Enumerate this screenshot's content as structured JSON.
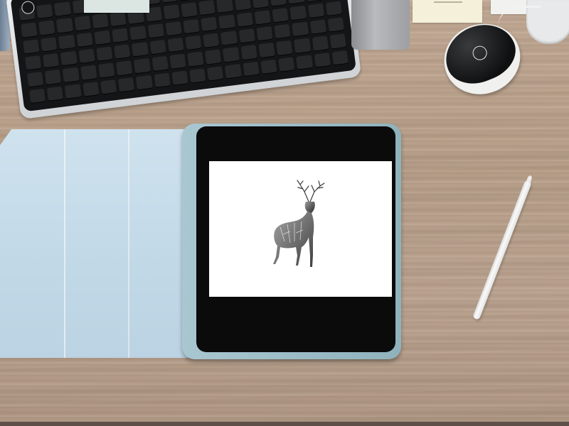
{
  "scene": {
    "colors": {
      "desk": "#bca591",
      "case": "#c4dae8",
      "tablet_bezel": "#0b0b0c",
      "screen": "#ffffff",
      "keyboard": "#141516",
      "mouse": "#0f1011",
      "pencil": "#f4f4f4"
    },
    "icons": [
      "keyboard-logo-icon",
      "mouse-logo-icon",
      "deer-artwork-icon"
    ]
  }
}
